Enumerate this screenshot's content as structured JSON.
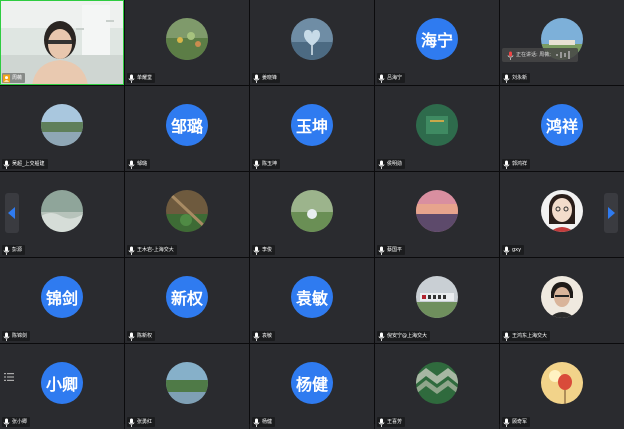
{
  "speaking": {
    "label": "正在讲话: 周薇;"
  },
  "colors": {
    "tile_bg": "#2a2b2f",
    "avatar_blue": "#2f7bf0",
    "active_border": "#2ecc40"
  },
  "tiles": [
    {
      "name": "周薇",
      "avatar_text": ""
    },
    {
      "name": "单耀堂",
      "avatar_text": ""
    },
    {
      "name": "姜晓锋",
      "avatar_text": ""
    },
    {
      "name": "吕海宁",
      "avatar_text": "海宁"
    },
    {
      "name": "刘永新",
      "avatar_text": ""
    },
    {
      "name": "吴超_上交船建",
      "avatar_text": ""
    },
    {
      "name": "邹璐",
      "avatar_text": "邹璐"
    },
    {
      "name": "陈玉坤",
      "avatar_text": "玉坤"
    },
    {
      "name": "侯明勋",
      "avatar_text": ""
    },
    {
      "name": "郭鸿祥",
      "avatar_text": "鸿祥"
    },
    {
      "name": "彭源",
      "avatar_text": ""
    },
    {
      "name": "王木岩-上海交大",
      "avatar_text": ""
    },
    {
      "name": "李俊",
      "avatar_text": ""
    },
    {
      "name": "蔡国平",
      "avatar_text": ""
    },
    {
      "name": "gxy",
      "avatar_text": ""
    },
    {
      "name": "陈锦剑",
      "avatar_text": "锦剑"
    },
    {
      "name": "陈新权",
      "avatar_text": "新权"
    },
    {
      "name": "袁敏",
      "avatar_text": "袁敏"
    },
    {
      "name": "倪安宁@上海交大",
      "avatar_text": ""
    },
    {
      "name": "王鸿东上海交大",
      "avatar_text": ""
    },
    {
      "name": "张小卿",
      "avatar_text": "小卿"
    },
    {
      "name": "张勇红",
      "avatar_text": ""
    },
    {
      "name": "杨健",
      "avatar_text": "杨健"
    },
    {
      "name": "王喜芳",
      "avatar_text": ""
    },
    {
      "name": "顾奇军",
      "avatar_text": ""
    }
  ]
}
